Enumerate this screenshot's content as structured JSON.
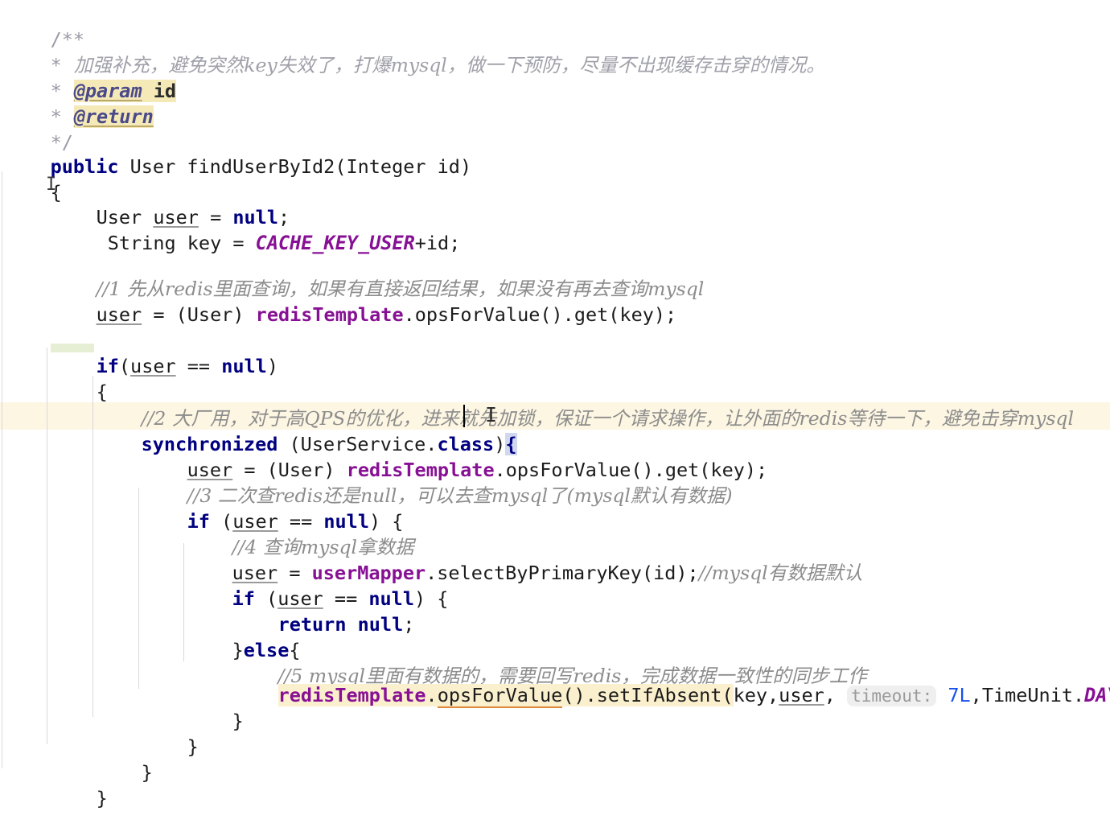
{
  "editor": {
    "language": "Java",
    "colors": {
      "background": "#ffffff",
      "keyword": "#000080",
      "field": "#871094",
      "comment": "#8c8c8c",
      "number": "#1750eb",
      "current_line_highlight": "#fdf6e3",
      "javadoc_tag_highlight": "#f6e9b8",
      "brace_match_highlight": "#cfd8ef",
      "indent_guide": "#d8d8dd",
      "inlay_hint": "#9a9a9a",
      "warning_underline": "#e08a3c"
    }
  },
  "javadoc": {
    "open": "/**",
    "star": "*",
    "summary": "加强补充，避免突然key失效了，打爆mysql，做一下预防，尽量不出现缓存击穿的情况。",
    "param_tag": "@param",
    "param_name": "id",
    "return_tag": "@return",
    "close": "*/"
  },
  "signature": {
    "modifier": "public",
    "return_type": "User",
    "method_name": "findUserById2",
    "params": "(Integer id)",
    "open_brace": "{",
    "close_brace": "}"
  },
  "code": {
    "decl_user": "User ",
    "decl_user_var": "user",
    "decl_user_tail": " = ",
    "null_kw": "null",
    "semi": ";",
    "decl_key": " String key = ",
    "cache_key_const": "CACHE_KEY_USER",
    "decl_key_tail": "+id;",
    "comment_1": "//1 先从redis里面查询，如果有直接返回结果，如果没有再去查询mysql",
    "redis_get_var": "user",
    "redis_get_mid": " = (User) ",
    "redis_template": "redisTemplate",
    "redis_get_tail": ".opsForValue().get(key);",
    "if_kw": "if",
    "if_open_paren": "(",
    "if_user": "user",
    "if_eq": " == ",
    "if_close_paren": ")",
    "brace_open": "{",
    "brace_close": "}",
    "comment_2": "//2 大厂用，对于高QPS的优化，进来就先加锁，保证一个请求操作，让外面的redis等待一下，避免击穿mysql",
    "sync_kw": "synchronized",
    "sync_arg": " (UserService.",
    "class_kw": "class",
    "sync_close_paren": ")",
    "sync_open_brace": "{",
    "comment_3": "//3 二次查redis还是null，可以去查mysql了(mysql默认有数据)",
    "if2_prefix": "if (",
    "if2_suffix": ") {",
    "comment_4": "//4 查询mysql拿数据",
    "mapper_var": "user",
    "mapper_mid": " = ",
    "user_mapper": "userMapper",
    "mapper_tail": ".selectByPrimaryKey(id);",
    "comment_mysql_inline": "//mysql有数据默认",
    "return_kw": "return",
    "else_kw": "else",
    "else_prefix": "}",
    "else_suffix": "{",
    "comment_5": "//5 mysql里面有数据的，需要回写redis，完成数据一致性的同步工作",
    "set_template": "redisTemplate",
    "set_dot": ".",
    "set_ops": "opsForValue",
    "set_ops_tail": "().",
    "set_method": "setIfAbsent",
    "set_args_open": "(key,",
    "set_args_user": "user",
    "set_args_comma": ", ",
    "timeout_hint": "timeout:",
    "timeout_value": "7L",
    "set_args_unit": ",TimeUnit.",
    "days_const": "DAYS",
    "set_args_close": ");"
  },
  "cursors": {
    "caret_label": "text-caret",
    "mouse_label": "i-beam-mouse-pointer"
  }
}
